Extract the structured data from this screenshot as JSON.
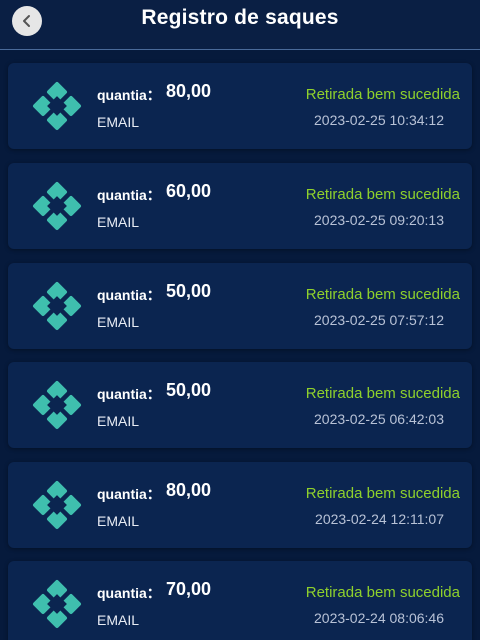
{
  "header": {
    "title": "Registro de saques"
  },
  "icons": {
    "back": "chevron-left-icon",
    "method": "pix-icon"
  },
  "colors": {
    "accent_status": "#8fd12c",
    "pix_icon": "#3fbfae",
    "card": "#0b2550",
    "background": "#061a3c"
  },
  "records": [
    {
      "label": "quantia：",
      "amount": "80,00",
      "method": "EMAIL",
      "status": "Retirada bem sucedida",
      "timestamp": "2023-02-25 10:34:12"
    },
    {
      "label": "quantia：",
      "amount": "60,00",
      "method": "EMAIL",
      "status": "Retirada bem sucedida",
      "timestamp": "2023-02-25 09:20:13"
    },
    {
      "label": "quantia：",
      "amount": "50,00",
      "method": "EMAIL",
      "status": "Retirada bem sucedida",
      "timestamp": "2023-02-25 07:57:12"
    },
    {
      "label": "quantia：",
      "amount": "50,00",
      "method": "EMAIL",
      "status": "Retirada bem sucedida",
      "timestamp": "2023-02-25 06:42:03"
    },
    {
      "label": "quantia：",
      "amount": "80,00",
      "method": "EMAIL",
      "status": "Retirada bem sucedida",
      "timestamp": "2023-02-24 12:11:07"
    },
    {
      "label": "quantia：",
      "amount": "70,00",
      "method": "EMAIL",
      "status": "Retirada bem sucedida",
      "timestamp": "2023-02-24 08:06:46"
    }
  ]
}
